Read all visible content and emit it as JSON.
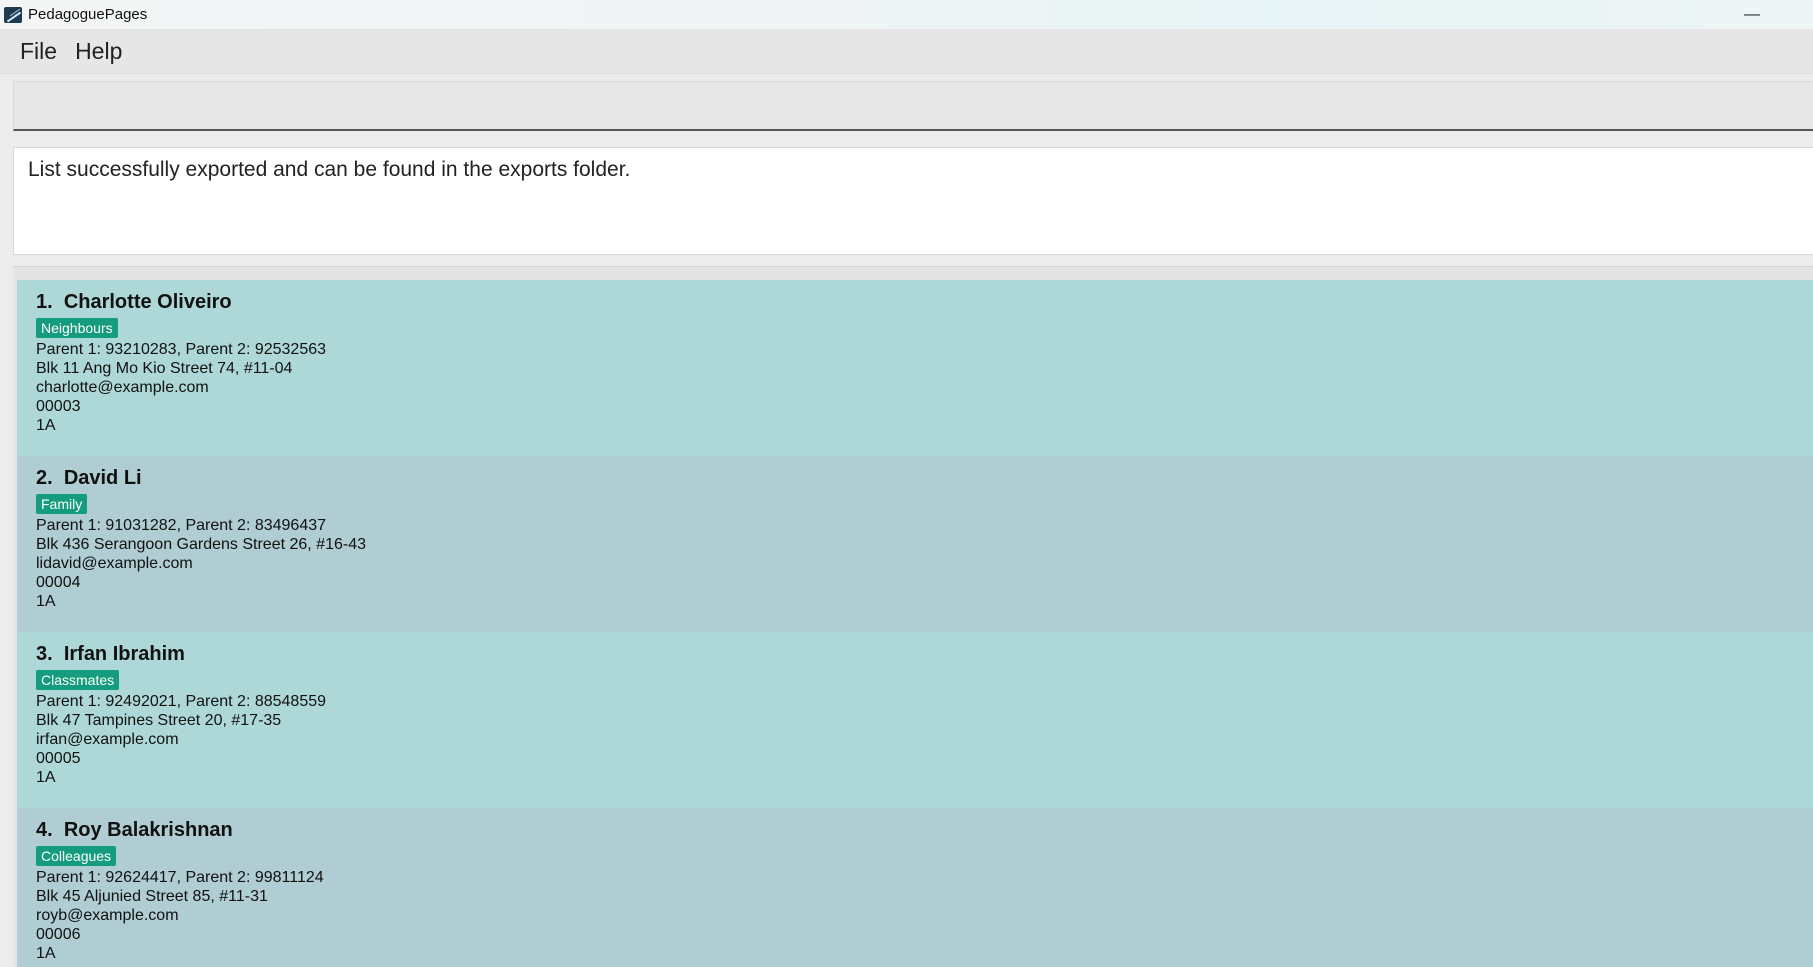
{
  "window": {
    "title": "PedagoguePages",
    "minimize_symbol": "—"
  },
  "menu": {
    "items": [
      "File",
      "Help"
    ]
  },
  "command": {
    "value": "",
    "placeholder": ""
  },
  "result": {
    "message": "List successfully exported and can be found in the exports folder."
  },
  "persons": [
    {
      "index": "1.",
      "name": "Charlotte Oliveiro",
      "tag": "Neighbours",
      "parents": "Parent 1: 93210283, Parent 2: 92532563",
      "address": "Blk 11 Ang Mo Kio Street 74, #11-04",
      "email": "charlotte@example.com",
      "id": "00003",
      "class": "1A"
    },
    {
      "index": "2.",
      "name": "David Li",
      "tag": "Family",
      "parents": "Parent 1: 91031282, Parent 2: 83496437",
      "address": "Blk 436 Serangoon Gardens Street 26, #16-43",
      "email": "lidavid@example.com",
      "id": "00004",
      "class": "1A"
    },
    {
      "index": "3.",
      "name": "Irfan Ibrahim",
      "tag": "Classmates",
      "parents": "Parent 1: 92492021, Parent 2: 88548559",
      "address": "Blk 47 Tampines Street 20, #17-35",
      "email": "irfan@example.com",
      "id": "00005",
      "class": "1A"
    },
    {
      "index": "4.",
      "name": "Roy Balakrishnan",
      "tag": "Colleagues",
      "parents": "Parent 1: 92624417, Parent 2: 99811124",
      "address": "Blk 45 Aljunied Street 85, #11-31",
      "email": "royb@example.com",
      "id": "00006",
      "class": "1A"
    }
  ],
  "colors": {
    "card_odd": "#aed8d8",
    "card_even": "#afcdd3",
    "tag_bg": "#159c7e"
  }
}
